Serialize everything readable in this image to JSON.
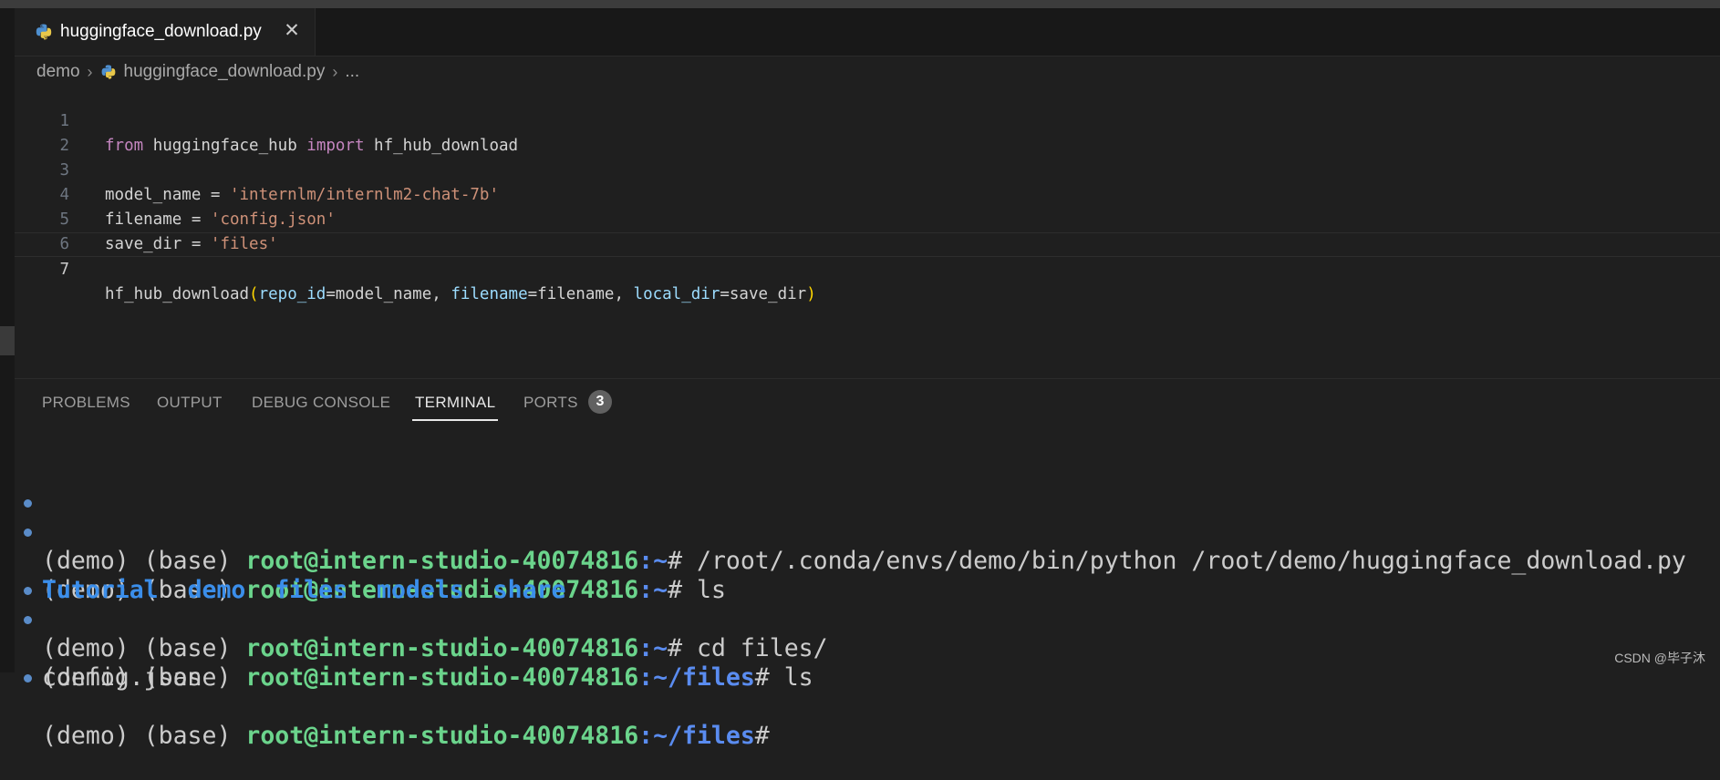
{
  "tab": {
    "filename": "huggingface_download.py",
    "close_glyph": "✕"
  },
  "breadcrumb": {
    "folder": "demo",
    "file": "huggingface_download.py",
    "more": "..."
  },
  "code": {
    "line1": {
      "n": "1",
      "kw1": "from",
      "mod": " huggingface_hub ",
      "kw2": "import",
      "name": " hf_hub_download"
    },
    "line2": {
      "n": "2"
    },
    "line3": {
      "n": "3",
      "lhs": "model_name = ",
      "str": "'internlm/internlm2-chat-7b'"
    },
    "line4": {
      "n": "4",
      "lhs": "filename = ",
      "str": "'config.json'"
    },
    "line5": {
      "n": "5",
      "lhs": "save_dir = ",
      "str": "'files'"
    },
    "line6": {
      "n": "6"
    },
    "line7": {
      "n": "7",
      "fn": "hf_hub_download",
      "open": "(",
      "p1": "repo_id",
      "v1": "=model_name, ",
      "p2": "filename",
      "v2": "=filename, ",
      "p3": "local_dir",
      "v3": "=save_dir",
      "close": ")"
    }
  },
  "panel": {
    "tabs": [
      "PROBLEMS",
      "OUTPUT",
      "DEBUG CONSOLE",
      "TERMINAL",
      "PORTS"
    ],
    "active": "TERMINAL",
    "ports_count": "3"
  },
  "terminal": {
    "prompt_prefix": "(demo) (base) ",
    "host": "root@intern-studio-40074816",
    "lines": [
      {
        "path": ":~",
        "cmd": "# /root/.conda/envs/demo/bin/python /root/demo/huggingface_download.py"
      },
      {
        "path": ":~",
        "cmd": "# ls"
      },
      {
        "dirs": [
          "Tutorial",
          "demo",
          "files",
          "models",
          "share"
        ]
      },
      {
        "path": ":~",
        "cmd": "# cd files/"
      },
      {
        "path": ":~/files",
        "cmd": "# ls"
      },
      {
        "output": "config.json"
      },
      {
        "path": ":~/files",
        "cmd": "#"
      }
    ]
  },
  "watermark": "CSDN @毕子沐",
  "colors": {
    "accent_host": "#6bd48c",
    "dir_blue": "#3b8eea",
    "keyword": "#c586c0",
    "string": "#ce9178"
  }
}
